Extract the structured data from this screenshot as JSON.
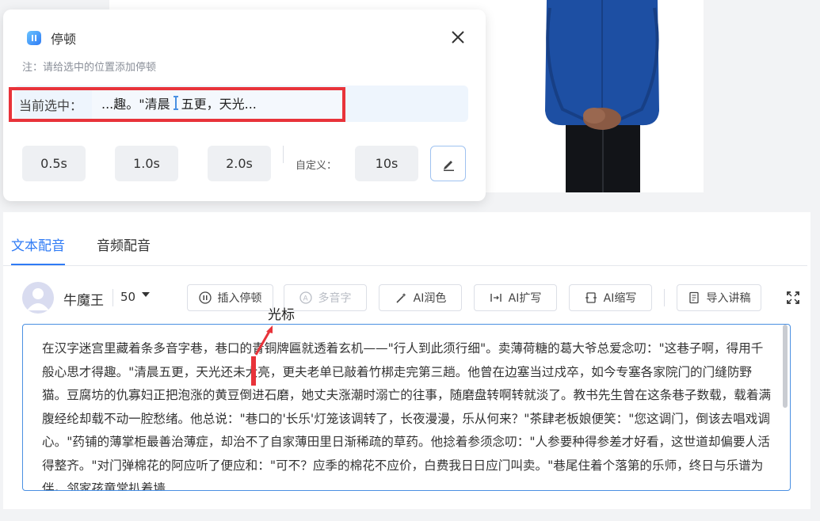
{
  "popup": {
    "title": "停顿",
    "note": "注：请给选中的位置添加停顿",
    "selection_label": "当前选中：",
    "selection_before": "...趣。\"清晨",
    "selection_after": "五更，天光...",
    "options": [
      "0.5s",
      "1.0s",
      "2.0s"
    ],
    "custom_label": "自定义：",
    "custom_value": "10s"
  },
  "tabs": [
    "文本配音",
    "音频配音"
  ],
  "toolbar": {
    "voice_name": "牛魔王",
    "speed": "50",
    "buttons": {
      "insert_pause": "插入停顿",
      "polyphone": "多音字",
      "ai_polish": "AI润色",
      "ai_expand": "AI扩写",
      "ai_shorten": "AI缩写",
      "import_script": "导入讲稿"
    }
  },
  "annotation": {
    "label": "光标"
  },
  "editor": {
    "text": "在汉字迷宫里藏着条多音字巷，巷口的青铜牌匾就透着玄机——\"行人到此须行细\"。卖薄荷糖的葛大爷总爱念叨：\"这巷子啊，得用千般心思才得趣。\"清晨五更，天光还未大亮，更夫老单已敲着竹梆走完第三趟。他曾在边塞当过戍卒，如今专塞各家院门的门缝防野猫。豆腐坊的仇寡妇正把泡涨的黄豆倒进石磨，她丈夫涨潮时溺亡的往事，随磨盘转啊转就淡了。教书先生曾在这条巷子数载，载着满腹经纶却载不动一腔愁绪。他总说：\"巷口的'长乐'灯笼该调转了，长夜漫漫，乐从何来？\"茶肆老板娘便笑：\"您这调门，倒该去唱戏调心。\"药铺的薄掌柜最善治薄症，却治不了自家薄田里日渐稀疏的草药。他捻着参须念叨：\"人参要种得参差才好看，这世道却偏要人活得整齐。\"对门弹棉花的阿应听了便应和：\"可不？应季的棉花不应价，白费我日日应门叫卖。\"巷尾住着个落第的乐师，终日与乐谱为伴。邻家孩童常扒着墙"
  },
  "colors": {
    "accent": "#2f7bf5",
    "highlight_border": "#e8333a",
    "shirt": "#1d4fa3",
    "pants": "#121418"
  }
}
